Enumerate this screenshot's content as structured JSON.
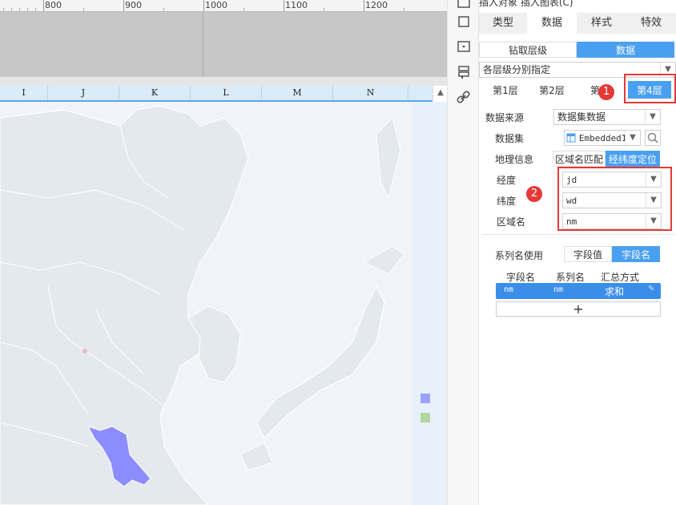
{
  "ruler": {
    "labels": [
      "800",
      "900",
      "1000",
      "1100",
      "1200"
    ]
  },
  "sheet": {
    "columns": [
      "I",
      "J",
      "K",
      "L",
      "M",
      "N"
    ]
  },
  "legend": {
    "colors": [
      "#9aa2ff",
      "#b3d6a0"
    ]
  },
  "map": {
    "highlight_color": "#8c8cff",
    "land_color": "#e4e9ee",
    "sea_color": "#f0f4f8"
  },
  "panel": {
    "top_truncated": "插入对象    插入图表(C)",
    "tabs": [
      "类型",
      "数据",
      "样式",
      "特效"
    ],
    "active_tab": "数据",
    "mode": {
      "drill": "钻取层级",
      "data": "数据"
    },
    "level_mode": "各层级分别指定",
    "layers": [
      "第1层",
      "第2层",
      "第",
      "第4层"
    ],
    "source_label": "数据来源",
    "source_value": "数据集数据",
    "dataset_label": "数据集",
    "dataset_value": "Embedded1",
    "geo_label": "地理信息",
    "geo_options": [
      "区域名匹配",
      "经纬度定位"
    ],
    "lng_label": "经度",
    "lng_value": "jd",
    "lat_label": "纬度",
    "lat_value": "wd",
    "area_label": "区域名",
    "area_value": "nm",
    "series_label": "系列名使用",
    "series_options": [
      "字段值",
      "字段名"
    ],
    "grid_headers": [
      "字段名",
      "系列名",
      "汇总方式"
    ],
    "grid_row": {
      "field": "nm",
      "series": "nm",
      "agg": "求和"
    },
    "add": "+",
    "badges": [
      "1",
      "2"
    ]
  },
  "accent": "#4aa0f0",
  "annotation_color": "#e53935"
}
